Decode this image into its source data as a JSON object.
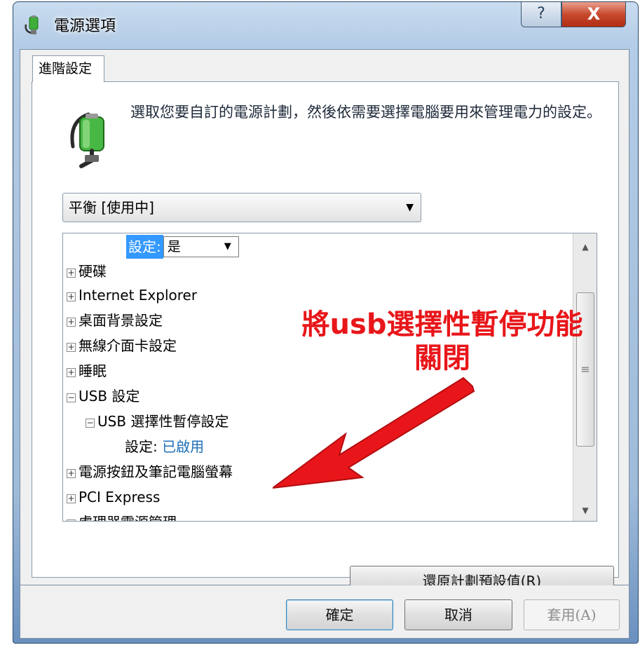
{
  "window": {
    "title": "電源選項",
    "help_label": "?",
    "close_label": "X"
  },
  "tab": {
    "label": "進階設定"
  },
  "description": "選取您要自訂的電源計劃，然後依需要選擇電腦要用來管理電力的設定。",
  "plan": {
    "selected": "平衡 [使用中]"
  },
  "tree": {
    "top_setting": {
      "label": "設定:",
      "value": "是"
    },
    "items": [
      {
        "label": "硬碟",
        "expander": "+"
      },
      {
        "label": "Internet Explorer",
        "expander": "+"
      },
      {
        "label": "桌面背景設定",
        "expander": "+"
      },
      {
        "label": "無線介面卡設定",
        "expander": "+"
      },
      {
        "label": "睡眠",
        "expander": "+"
      },
      {
        "label": "USB 設定",
        "expander": "−"
      },
      {
        "label": "USB 選擇性暫停設定",
        "expander": "−"
      },
      {
        "label": "設定:",
        "value": "已啟用"
      },
      {
        "label": "電源按鈕及筆記電腦螢幕",
        "expander": "+"
      },
      {
        "label": "PCI Express",
        "expander": "+"
      },
      {
        "label": "處理器電源管理",
        "expander": "+"
      }
    ]
  },
  "annotation": {
    "line1": "將usb選擇性暫停功能",
    "line2": "關閉",
    "color": "#e8161a"
  },
  "buttons": {
    "restore": "還原計劃預設值(R)",
    "ok": "確定",
    "cancel": "取消",
    "apply": "套用(A)"
  }
}
